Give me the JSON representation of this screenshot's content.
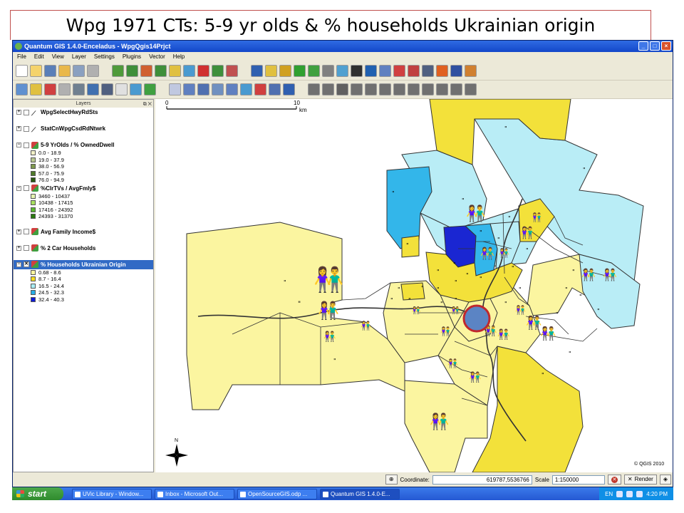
{
  "slide": {
    "title": "Wpg 1971 CTs: 5-9 yr olds & % households Ukrainian origin"
  },
  "window": {
    "title": "Quantum GIS 1.4.0-Enceladus - WpgQgis14Prjct",
    "buttons": {
      "minimize": "_",
      "maximize": "□",
      "close": "×"
    }
  },
  "menu": [
    "File",
    "Edit",
    "View",
    "Layer",
    "Settings",
    "Plugins",
    "Vector",
    "Help"
  ],
  "layers_panel": {
    "title": "Layers",
    "layers": [
      {
        "name": "WpgSelectHwyRdSts",
        "icon": "line-layer-icon",
        "checked": "",
        "legend": []
      },
      {
        "name": "StatCnWpgCsdRdNtwrk",
        "icon": "line-layer-icon",
        "checked": "",
        "legend": []
      },
      {
        "name": "5-9 YrOlds / % OwnedDwell",
        "icon": "polygon-layer-icon",
        "checked": "",
        "legend": [
          {
            "label": "0.0 - 18.9",
            "color": "#f2f0c8"
          },
          {
            "label": "19.0 - 37.9",
            "color": "#b9c890"
          },
          {
            "label": "38.0 - 56.9",
            "color": "#7f9a4e"
          },
          {
            "label": "57.0 - 75.9",
            "color": "#4f7a2a"
          },
          {
            "label": "76.0 - 94.9",
            "color": "#2b5a12"
          }
        ]
      },
      {
        "name": "%ClrTVs / AvgFmly$",
        "icon": "polygon-layer-icon",
        "checked": "",
        "legend": [
          {
            "label": "3460 - 10437",
            "color": "#e5f5b0"
          },
          {
            "label": "10438 - 17415",
            "color": "#a8e060"
          },
          {
            "label": "17416 - 24392",
            "color": "#5cb830"
          },
          {
            "label": "24393 - 31370",
            "color": "#2a7a10"
          }
        ]
      },
      {
        "name": "Avg Family Income$",
        "icon": "polygon-layer-icon",
        "checked": "",
        "legend": []
      },
      {
        "name": "% 2 Car Households",
        "icon": "polygon-layer-icon",
        "checked": "",
        "legend": []
      },
      {
        "name": "% Households Ukrainian Origin",
        "icon": "polygon-layer-icon",
        "checked": "✕",
        "selected": true,
        "legend": [
          {
            "label": "0.68 - 8.6",
            "color": "#fff6a0"
          },
          {
            "label": "8.7 - 16.4",
            "color": "#f5dc1e"
          },
          {
            "label": "16.5 - 24.4",
            "color": "#a8ecf4"
          },
          {
            "label": "24.5 - 32.3",
            "color": "#27aee6"
          },
          {
            "label": "32.4 - 40.3",
            "color": "#0f1bd8"
          }
        ]
      }
    ]
  },
  "map": {
    "scalebar": {
      "start": "0",
      "end": "10",
      "unit": "km"
    },
    "north_label": "N",
    "copyright": "© QGIS 2010",
    "colors": {
      "pale": "#fbf5a0",
      "yellow": "#f3e13a",
      "lightcyan": "#b9edf6",
      "cyan": "#33b6ea",
      "blue": "#1a26d2",
      "marker": "#5b84c4",
      "marker_ring": "#c0282d"
    }
  },
  "statusbar": {
    "coordinate_label": "Coordinate:",
    "coordinate_value": "619787,5536766",
    "scale_label": "Scale",
    "scale_value": "1:150000",
    "render_label": "Render"
  },
  "taskbar": {
    "start_label": "start",
    "items": [
      "UVic Library - Window...",
      "Inbox - Microsoft Out...",
      "OpenSourceGIS.odp ...",
      "Quantum GIS 1.4.0-E..."
    ],
    "language": "EN",
    "clock": "4:20 PM"
  }
}
